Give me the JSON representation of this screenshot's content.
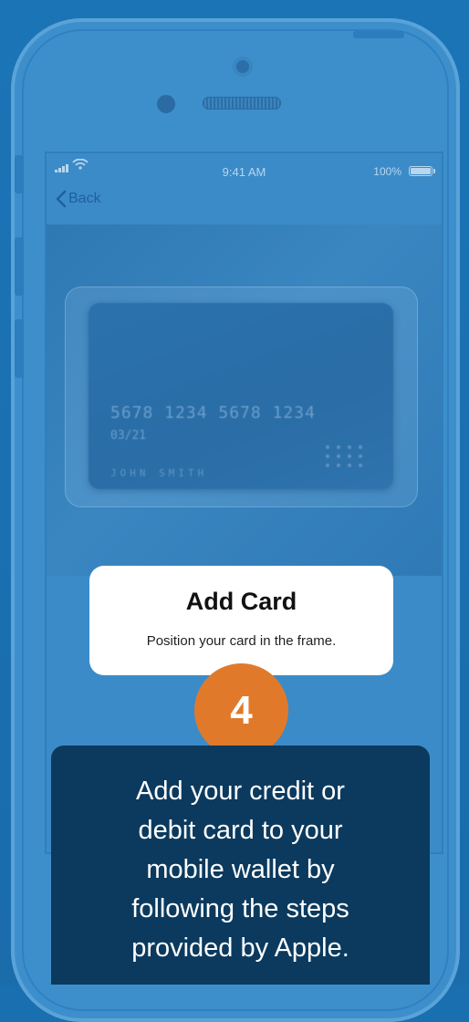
{
  "status_bar": {
    "time": "9:41 AM",
    "battery": "100%"
  },
  "nav": {
    "back_label": "Back"
  },
  "card": {
    "number": "5678 1234 5678 1234",
    "expiry": "03/21",
    "holder": "JOHN SMITH"
  },
  "panel": {
    "title": "Add Card",
    "subtitle": "Position your card in the frame."
  },
  "step": {
    "number": "4"
  },
  "instruction": {
    "lines": [
      "Add your credit or",
      "debit card to your",
      "mobile wallet by",
      "following the steps",
      "provided by Apple."
    ]
  },
  "colors": {
    "background": "#1a6fb0",
    "phone": "#3d8fcc",
    "accent": "#e07a2a",
    "instruction_bg": "#0b3a5e"
  },
  "icons": {
    "signal": "signal-icon",
    "wifi": "wifi-icon",
    "battery": "battery-icon",
    "back": "chevron-left-icon"
  }
}
